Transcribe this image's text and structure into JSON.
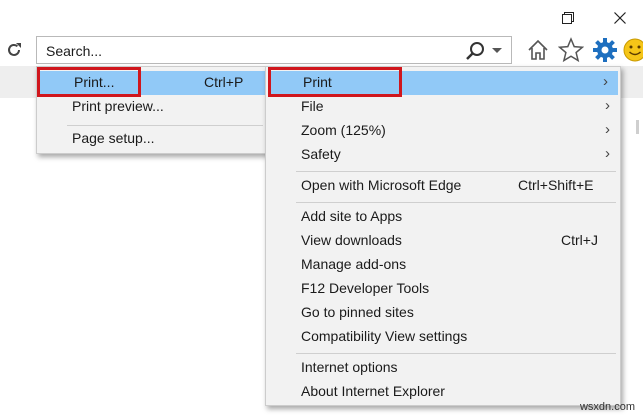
{
  "window": {
    "restore_icon": "restore-icon",
    "close_icon": "close-icon"
  },
  "toolbar": {
    "refresh_icon": "refresh-icon",
    "address_text": "Search...",
    "search_icon": "search-icon",
    "home_icon": "home-icon",
    "favorites_icon": "star-icon",
    "tools_icon": "gear-icon",
    "feedback_icon": "smiley-icon"
  },
  "tools_menu": {
    "items": [
      {
        "label": "Print",
        "shortcut": "",
        "submenu": true,
        "highlighted": true
      },
      {
        "label": "File",
        "shortcut": "",
        "submenu": true
      },
      {
        "label": "Zoom (125%)",
        "shortcut": "",
        "submenu": true
      },
      {
        "label": "Safety",
        "shortcut": "",
        "submenu": true
      },
      {
        "label": "Open with Microsoft Edge",
        "shortcut": "Ctrl+Shift+E"
      },
      {
        "label": "Add site to Apps",
        "shortcut": ""
      },
      {
        "label": "View downloads",
        "shortcut": "Ctrl+J"
      },
      {
        "label": "Manage add-ons",
        "shortcut": ""
      },
      {
        "label": "F12 Developer Tools",
        "shortcut": ""
      },
      {
        "label": "Go to pinned sites",
        "shortcut": ""
      },
      {
        "label": "Compatibility View settings",
        "shortcut": ""
      },
      {
        "label": "Internet options",
        "shortcut": ""
      },
      {
        "label": "About Internet Explorer",
        "shortcut": ""
      }
    ],
    "submenu_arrow": "›"
  },
  "print_submenu": {
    "items": [
      {
        "label": "Print...",
        "shortcut": "Ctrl+P",
        "highlighted": true
      },
      {
        "label": "Print preview...",
        "shortcut": ""
      },
      {
        "label": "Page setup...",
        "shortcut": ""
      }
    ]
  },
  "watermark": "wsxdn.com",
  "colors": {
    "highlight": "#91c9f7",
    "annotation_box": "#d0161d",
    "menu_bg": "#f2f2f2",
    "gear_blue": "#1e6fbf",
    "smiley_yellow": "#f5c518"
  }
}
